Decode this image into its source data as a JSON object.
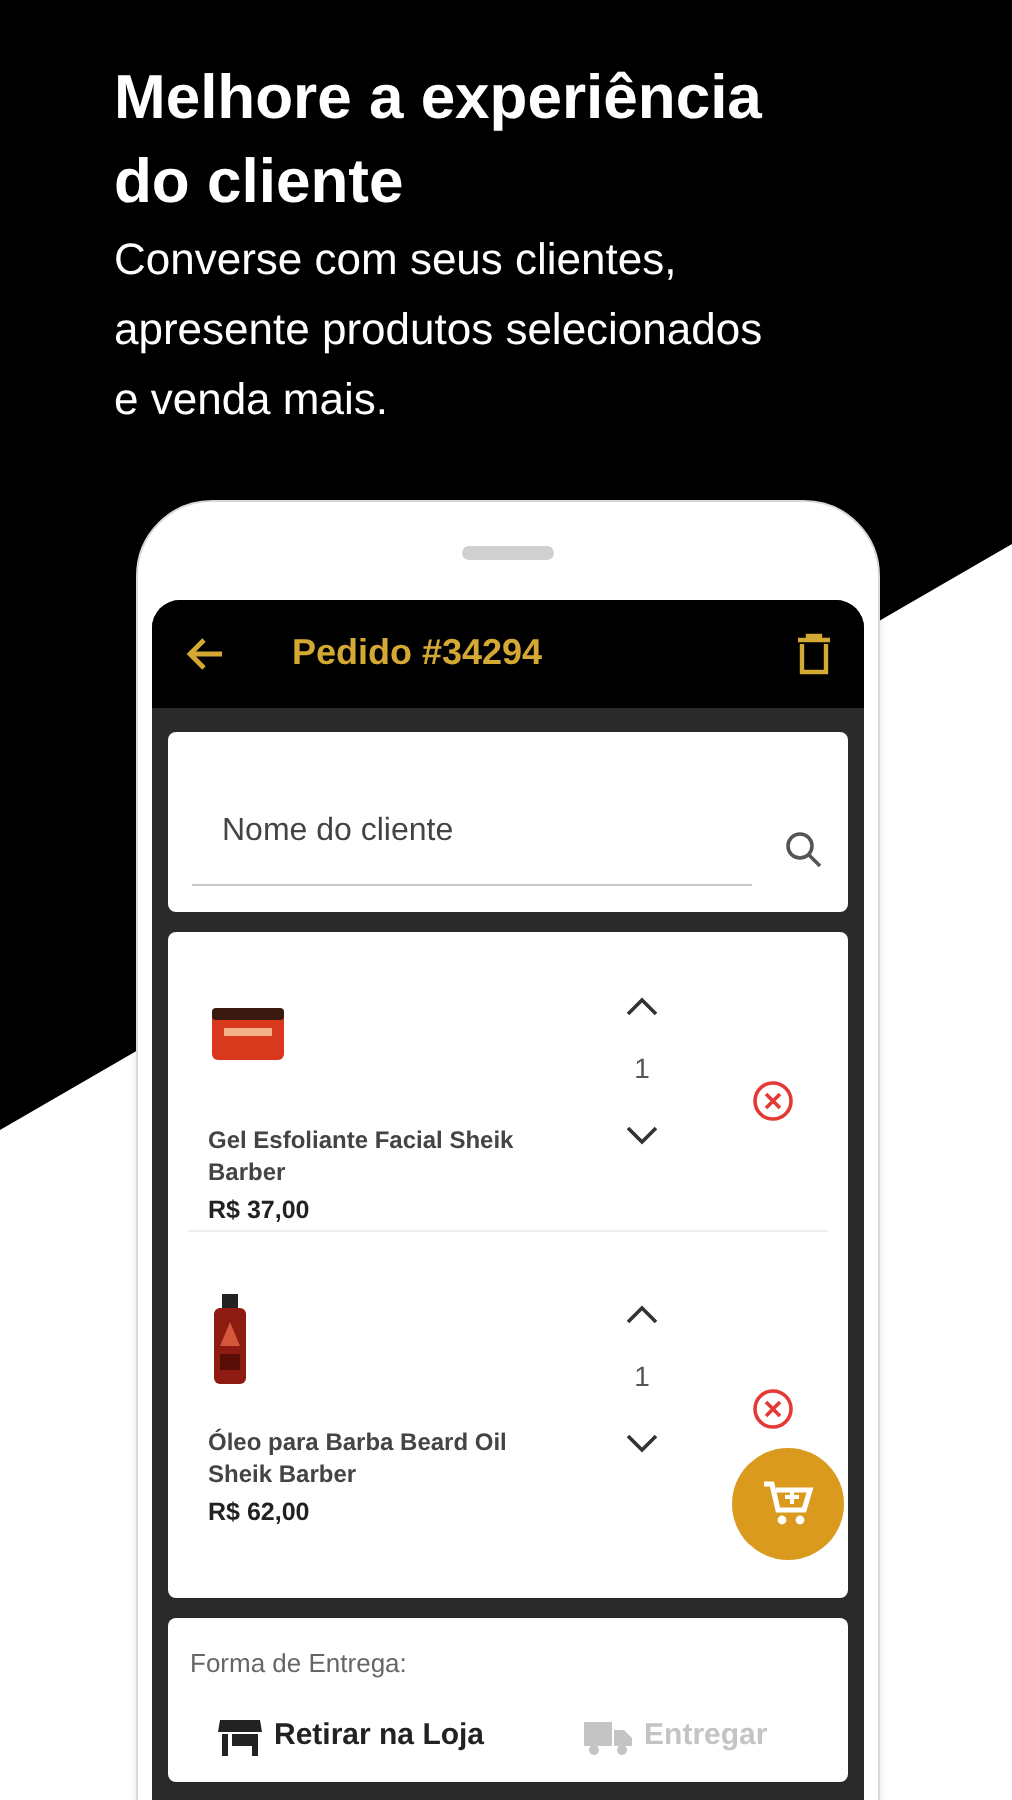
{
  "headline": "Melhore a experiência do cliente",
  "subheadline": "Converse com seus clientes, apresente produtos selecionados e venda mais.",
  "app_bar": {
    "title": "Pedido #34294"
  },
  "customer_search": {
    "placeholder": "Nome do cliente"
  },
  "items": [
    {
      "name": "Gel Esfoliante Facial Sheik Barber",
      "price": "R$ 37,00",
      "quantity": "1"
    },
    {
      "name": "Óleo para Barba Beard Oil Sheik Barber",
      "price": "R$ 62,00",
      "quantity": "1"
    }
  ],
  "delivery": {
    "label": "Forma de Entrega:",
    "options": [
      {
        "kind": "store",
        "label": "Retirar na Loja",
        "selected": true
      },
      {
        "kind": "truck",
        "label": "Entregar",
        "selected": false
      }
    ]
  }
}
